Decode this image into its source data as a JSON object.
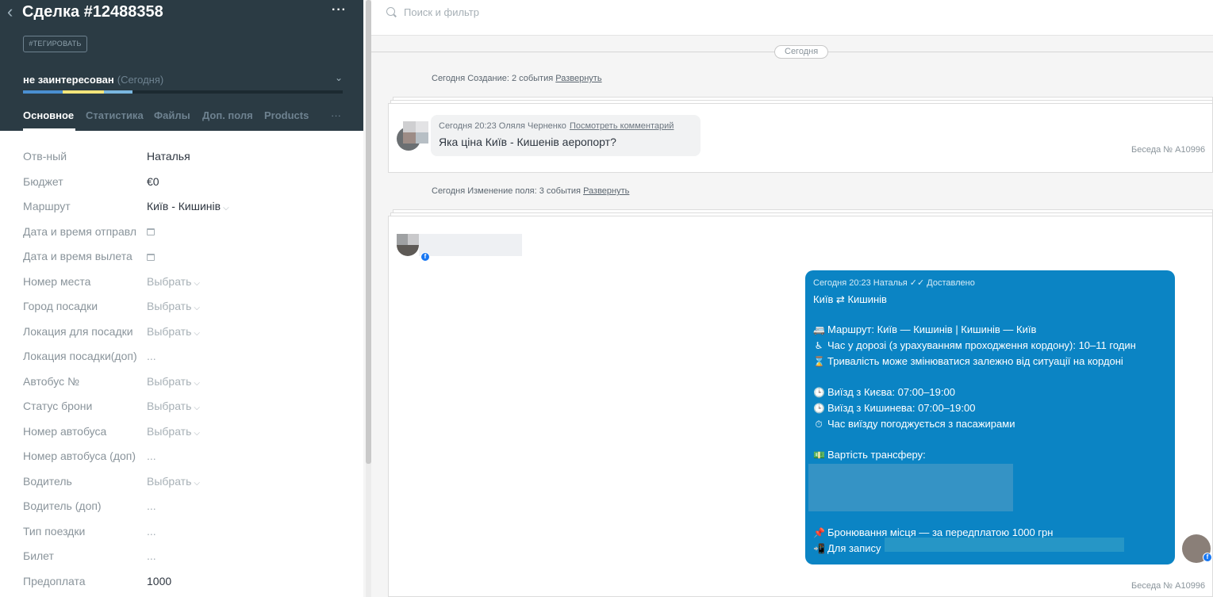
{
  "lead": {
    "title": "Сделка #12488358",
    "tag_button": "#ТЕГИРОВАТЬ",
    "status": "не заинтересован",
    "status_date": "(Сегодня)",
    "tabs": [
      "Основное",
      "Статистика",
      "Файлы",
      "Доп. поля",
      "Products"
    ],
    "more": "···",
    "pipeline_colors": [
      "#4a8fd1",
      "#f3e57a",
      "#7ab7e0",
      "#2c3d47"
    ]
  },
  "fields": [
    {
      "label": "Отв-ный",
      "value": "Наталья",
      "kind": "text"
    },
    {
      "label": "Бюджет",
      "value": "€0",
      "kind": "text"
    },
    {
      "label": "Маршрут",
      "value": "Київ - Кишинів",
      "kind": "select"
    },
    {
      "label": "Дата и время отправл",
      "value": "",
      "kind": "date"
    },
    {
      "label": "Дата и время вылета",
      "value": "",
      "kind": "date"
    },
    {
      "label": "Номер места",
      "value": "Выбрать",
      "kind": "select-muted"
    },
    {
      "label": "Город посадки",
      "value": "Выбрать",
      "kind": "select-muted"
    },
    {
      "label": "Локация для посадки",
      "value": "Выбрать",
      "kind": "select-muted"
    },
    {
      "label": "Локация посадки(доп)",
      "value": "...",
      "kind": "muted"
    },
    {
      "label": "Автобус №",
      "value": "Выбрать",
      "kind": "select-muted"
    },
    {
      "label": "Статус брони",
      "value": "Выбрать",
      "kind": "select-muted"
    },
    {
      "label": "Номер автобуса",
      "value": "Выбрать",
      "kind": "select-muted"
    },
    {
      "label": "Номер автобуса (доп)",
      "value": "...",
      "kind": "muted"
    },
    {
      "label": "Водитель",
      "value": "Выбрать",
      "kind": "select-muted"
    },
    {
      "label": "Водитель (доп)",
      "value": "...",
      "kind": "muted"
    },
    {
      "label": "Тип поездки",
      "value": "...",
      "kind": "muted"
    },
    {
      "label": "Билет",
      "value": "...",
      "kind": "muted"
    },
    {
      "label": "Предоплата",
      "value": "1000",
      "kind": "text"
    }
  ],
  "feed": {
    "search_placeholder": "Поиск и фильтр",
    "day_badge": "Сегодня",
    "event1": {
      "text": "Сегодня Создание: 2 события",
      "link": "Развернуть"
    },
    "event2": {
      "text": "Сегодня Изменение поля: 3 события",
      "link": "Развернуть"
    },
    "comment": {
      "meta": "Сегодня 20:23 Оляля Черненко",
      "link": "Посмотреть комментарий",
      "text": "Яка ціна Київ - Кишенів аеропорт?"
    },
    "chat_id": "Беседа № A10996",
    "outgoing": {
      "meta": "Сегодня 20:23 Наталья ✓✓ Доставлено",
      "title": "Київ ⇄ Кишинів",
      "lines": [
        {
          "icon": "🚐",
          "text": "Маршрут: Київ — Кишинів | Кишинів — Київ"
        },
        {
          "icon": "♿",
          "text": "Час у дорозі (з урахуванням проходження кордону): 10–11 годин"
        },
        {
          "icon": "⌛",
          "text": "Тривалість може змінюватися залежно від ситуації на кордоні"
        },
        {
          "icon": "🕒",
          "text": "Виїзд з Києва: 07:00–19:00"
        },
        {
          "icon": "🕒",
          "text": "Виїзд з Кишинева: 07:00–19:00"
        },
        {
          "icon": "⏱",
          "text": "Час виїзду погоджується з пасажирами"
        },
        {
          "icon": "💵",
          "text": "Вартість трансферу:"
        },
        {
          "icon": "📌",
          "text": "Бронювання місця — за передплатою 1000 грн"
        },
        {
          "icon": "📲",
          "text": "Для запису"
        }
      ]
    }
  }
}
